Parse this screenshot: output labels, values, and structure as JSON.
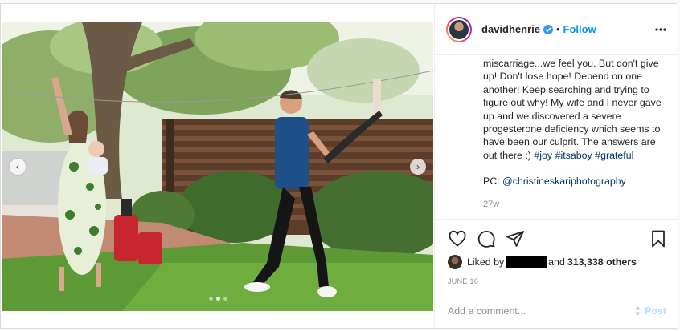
{
  "post": {
    "username": "davidhenrie",
    "separator": "•",
    "follow_label": "Follow",
    "caption": {
      "text": "miscarriage...we feel you. But don't give up! Don't lose hope! Depend on one another! Keep searching and trying to figure out why! My wife and I never gave up and we discovered a severe progesterone deficiency which seems to have been our culprit. The answers are out there :) ",
      "hashtags": [
        "#joy",
        "#itsaboy",
        "#grateful"
      ],
      "credit_prefix": "PC: ",
      "credit_handle": "@christineskariphotography",
      "time_ago": "27w"
    },
    "likes": {
      "prefix": "Liked by",
      "and_text": "and",
      "count_text": "313,338 others"
    },
    "date": "JUNE 16",
    "comment": {
      "placeholder": "Add a comment...",
      "post_label": "Post"
    },
    "carousel": {
      "dot_count": 3,
      "active_dot": 1
    },
    "colors": {
      "accent": "#0095f6",
      "post_disabled": "#b2dffc",
      "hashtag": "#00376b"
    },
    "icons": {
      "prev": "chevron-left-icon",
      "next": "chevron-right-icon",
      "verified": "verified-badge-icon",
      "more": "more-options-icon",
      "like": "heart-icon",
      "comment": "comment-icon",
      "share": "share-icon",
      "save": "bookmark-icon"
    }
  }
}
